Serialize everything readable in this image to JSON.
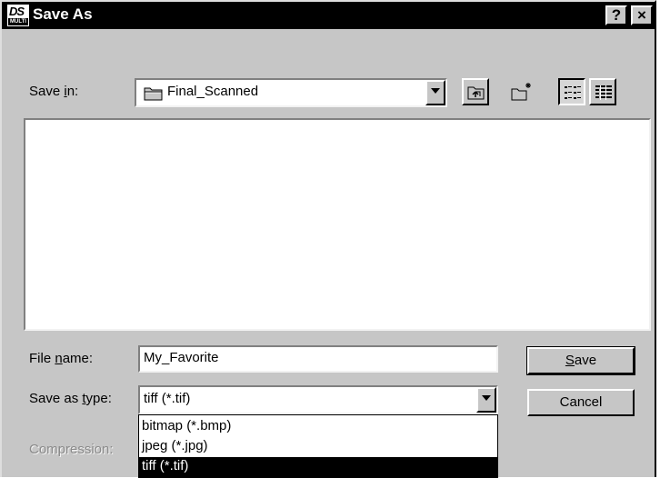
{
  "window": {
    "title": "Save As",
    "app_icon_text": "DS",
    "app_icon_subtext": "MULTI",
    "help_label": "?",
    "close_label": "×"
  },
  "save_in": {
    "label_pre": "Save ",
    "label_accel": "i",
    "label_post": "n:",
    "value": "Final_Scanned",
    "folder_icon": "folder-icon"
  },
  "toolbar": {
    "buttons": [
      {
        "name": "up-one-level-button",
        "icon": "up-folder-icon"
      },
      {
        "name": "create-new-folder-button",
        "icon": "new-folder-icon"
      },
      {
        "name": "list-view-button",
        "icon": "list-view-icon",
        "pressed": true
      },
      {
        "name": "details-view-button",
        "icon": "details-view-icon"
      }
    ]
  },
  "file_name": {
    "label_pre": "File ",
    "label_accel": "n",
    "label_post": "ame:",
    "value": "My_Favorite"
  },
  "save_as_type": {
    "label_pre": "Save as ",
    "label_accel": "t",
    "label_post": "ype:",
    "value": "tiff (*.tif)",
    "options": [
      "bitmap (*.bmp)",
      "jpeg (*.jpg)",
      "tiff (*.tif)"
    ],
    "selected_index": 2
  },
  "compression": {
    "label": "Compression:"
  },
  "buttons": {
    "save_accel": "S",
    "save_rest": "ave",
    "cancel": "Cancel"
  },
  "colors": {
    "face": "#c6c6c6",
    "title_bar": "#000000",
    "selection": "#000000"
  }
}
